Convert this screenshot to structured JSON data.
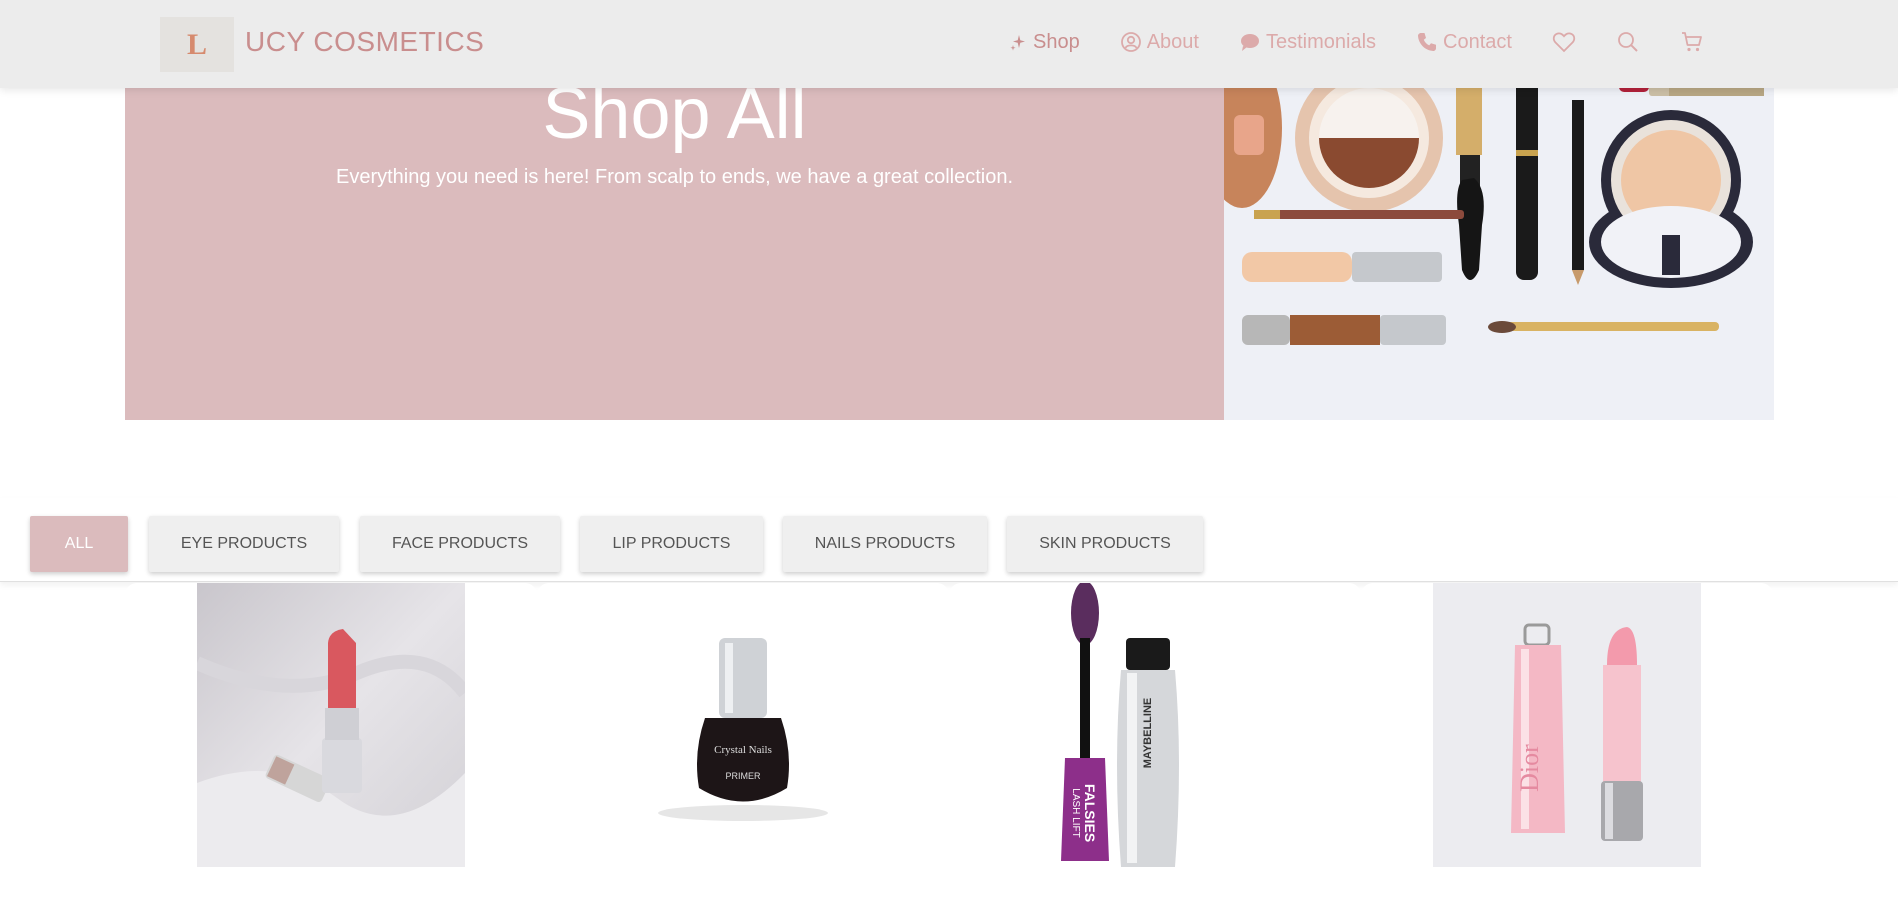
{
  "brand": {
    "logo_letter": "L",
    "name": "UCY COSMETICS"
  },
  "nav": {
    "items": [
      {
        "label": "Shop",
        "icon": "sparkle-icon",
        "active": true
      },
      {
        "label": "About",
        "icon": "user-circle-icon",
        "active": false
      },
      {
        "label": "Testimonials",
        "icon": "chat-bubble-icon",
        "active": false
      },
      {
        "label": "Contact",
        "icon": "phone-icon",
        "active": false
      }
    ],
    "icons": [
      "heart-icon",
      "search-icon",
      "cart-icon"
    ]
  },
  "hero": {
    "title": "Shop All",
    "subtitle": "Everything you need is here! From scalp to ends, we have a great collection.",
    "image": "makeup-flatlay-image"
  },
  "filters": [
    {
      "label": "ALL",
      "active": true
    },
    {
      "label": "EYE PRODUCTS",
      "active": false
    },
    {
      "label": "FACE PRODUCTS",
      "active": false
    },
    {
      "label": "LIP PRODUCTS",
      "active": false
    },
    {
      "label": "NAILS PRODUCTS",
      "active": false
    },
    {
      "label": "SKIN PRODUCTS",
      "active": false
    }
  ],
  "products": [
    {
      "image": "lipstick-image"
    },
    {
      "image": "nail-primer-image",
      "bottle_label_1": "Crystal Nails",
      "bottle_label_2": "PRIMER"
    },
    {
      "image": "mascara-image",
      "mascara_text_1": "FALSIES",
      "mascara_text_2": "LASH LIFT",
      "mascara_brand": "MAYBELLINE"
    },
    {
      "image": "lip-glow-image",
      "tube_text": "Dior"
    }
  ],
  "colors": {
    "accent": "#c98e8e",
    "nav_inactive": "#dcaaaa",
    "hero_bg": "#dbbbbd",
    "header_bg": "#ececec"
  }
}
